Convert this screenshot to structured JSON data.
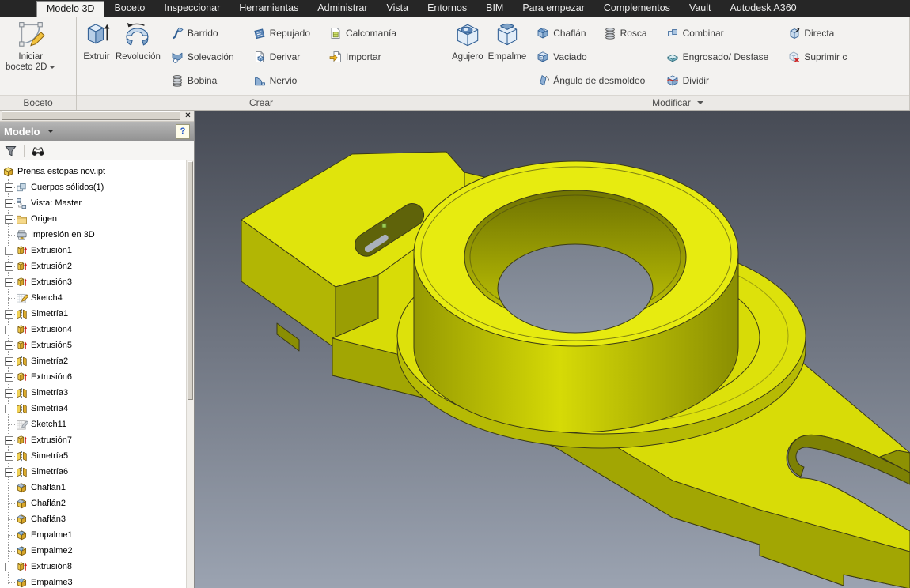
{
  "tabbar": {
    "tabs": [
      {
        "label": "Modelo 3D",
        "active": true
      },
      {
        "label": "Boceto"
      },
      {
        "label": "Inspeccionar"
      },
      {
        "label": "Herramientas"
      },
      {
        "label": "Administrar"
      },
      {
        "label": "Vista"
      },
      {
        "label": "Entornos"
      },
      {
        "label": "BIM"
      },
      {
        "label": "Para empezar"
      },
      {
        "label": "Complementos"
      },
      {
        "label": "Vault"
      },
      {
        "label": "Autodesk A360"
      }
    ]
  },
  "ribbon": {
    "panels": [
      {
        "name": "boceto",
        "footer": "Boceto",
        "big_buttons": [
          {
            "label_lines": [
              "Iniciar",
              "boceto 2D"
            ],
            "icon": "sketch-2d-icon",
            "dropdown": true
          }
        ],
        "small_columns": []
      },
      {
        "name": "crear",
        "footer": "Crear",
        "big_buttons": [
          {
            "label_lines": [
              "Extruir"
            ],
            "icon": "extrude-icon"
          },
          {
            "label_lines": [
              "Revolución"
            ],
            "icon": "revolve-icon"
          }
        ],
        "small_columns": [
          [
            [
              {
                "label": "Barrido",
                "icon": "sweep-icon"
              }
            ],
            [
              {
                "label": "Solevación",
                "icon": "loft-icon"
              }
            ],
            [
              {
                "label": "Bobina",
                "icon": "coil-icon"
              }
            ]
          ],
          [
            [
              {
                "label": "Repujado",
                "icon": "emboss-icon"
              }
            ],
            [
              {
                "label": "Derivar",
                "icon": "derive-icon"
              }
            ],
            [
              {
                "label": "Nervio",
                "icon": "rib-icon"
              }
            ]
          ],
          [
            [
              {
                "label": "Calcomanía",
                "icon": "decal-icon"
              }
            ],
            [
              {
                "label": "Importar",
                "icon": "import-icon"
              }
            ]
          ]
        ]
      },
      {
        "name": "modificar",
        "footer": "Modificar",
        "footer_dropdown": true,
        "big_buttons": [
          {
            "label_lines": [
              "Agujero"
            ],
            "icon": "hole-icon"
          },
          {
            "label_lines": [
              "Empalme"
            ],
            "icon": "fillet-icon"
          }
        ],
        "small_columns": [
          [
            [
              {
                "label": "Chaflán",
                "icon": "chamfer-icon"
              },
              {
                "label": "Rosca",
                "icon": "thread-icon"
              }
            ],
            [
              {
                "label": "Vaciado",
                "icon": "shell-icon"
              }
            ],
            [
              {
                "label": "Ángulo de desmoldeo",
                "icon": "draft-icon"
              }
            ]
          ],
          [
            [
              {
                "label": "Combinar",
                "icon": "combine-icon"
              }
            ],
            [
              {
                "label": "Engrosado/ Desfase",
                "icon": "thicken-icon"
              }
            ],
            [
              {
                "label": "Dividir",
                "icon": "split-icon"
              }
            ]
          ],
          [
            [
              {
                "label": "Directa",
                "icon": "direct-edit-icon"
              }
            ],
            [
              {
                "label": "Suprimir c",
                "icon": "delete-face-icon"
              }
            ]
          ]
        ]
      }
    ]
  },
  "browser": {
    "close_glyph": "✕",
    "header": {
      "title": "Modelo",
      "help_glyph": "?"
    },
    "tree": {
      "items": [
        {
          "label": "Prensa estopas nov.ipt",
          "icon": "part-icon",
          "expandable": false,
          "root": true
        },
        {
          "label": "Cuerpos sólidos(1)",
          "icon": "solid-bodies-icon",
          "expandable": true
        },
        {
          "label": "Vista: Master",
          "icon": "view-master-icon",
          "expandable": true
        },
        {
          "label": "Origen",
          "icon": "folder-icon",
          "expandable": true
        },
        {
          "label": "Impresión en 3D",
          "icon": "print-3d-icon",
          "expandable": false
        },
        {
          "label": "Extrusión1",
          "icon": "extrusion-icon",
          "expandable": true
        },
        {
          "label": "Extrusión2",
          "icon": "extrusion-icon",
          "expandable": true
        },
        {
          "label": "Extrusión3",
          "icon": "extrusion-icon",
          "expandable": true
        },
        {
          "label": "Sketch4",
          "icon": "sketch-icon",
          "expandable": false
        },
        {
          "label": "Simetría1",
          "icon": "mirror-icon",
          "expandable": true
        },
        {
          "label": "Extrusión4",
          "icon": "extrusion-icon",
          "expandable": true
        },
        {
          "label": "Extrusión5",
          "icon": "extrusion-icon",
          "expandable": true
        },
        {
          "label": "Simetría2",
          "icon": "mirror-icon",
          "expandable": true
        },
        {
          "label": "Extrusión6",
          "icon": "extrusion-icon",
          "expandable": true
        },
        {
          "label": "Simetría3",
          "icon": "mirror-icon",
          "expandable": true
        },
        {
          "label": "Simetría4",
          "icon": "mirror-icon",
          "expandable": true
        },
        {
          "label": "Sketch11",
          "icon": "sketch-gray-icon",
          "expandable": false
        },
        {
          "label": "Extrusión7",
          "icon": "extrusion-icon",
          "expandable": true
        },
        {
          "label": "Simetría5",
          "icon": "mirror-icon",
          "expandable": true
        },
        {
          "label": "Simetría6",
          "icon": "mirror-icon",
          "expandable": true
        },
        {
          "label": "Chaflán1",
          "icon": "chamfer-tree-icon",
          "expandable": false
        },
        {
          "label": "Chaflán2",
          "icon": "chamfer-tree-icon",
          "expandable": false
        },
        {
          "label": "Chaflán3",
          "icon": "chamfer-tree-icon",
          "expandable": false
        },
        {
          "label": "Empalme1",
          "icon": "fillet-tree-icon",
          "expandable": false
        },
        {
          "label": "Empalme2",
          "icon": "fillet-tree-icon",
          "expandable": false
        },
        {
          "label": "Extrusión8",
          "icon": "extrusion-icon",
          "expandable": true
        },
        {
          "label": "Empalme3",
          "icon": "fillet-tree-icon",
          "expandable": false
        }
      ]
    }
  },
  "viewport": {
    "scene": {
      "part_color": "#dde10b",
      "part_side_color": "#a2a603",
      "edge_color": "#3a3a16",
      "background_top": "#474b55",
      "background_bottom": "#9ba3b1",
      "vertex_marker_color": "#9ccd52"
    }
  }
}
